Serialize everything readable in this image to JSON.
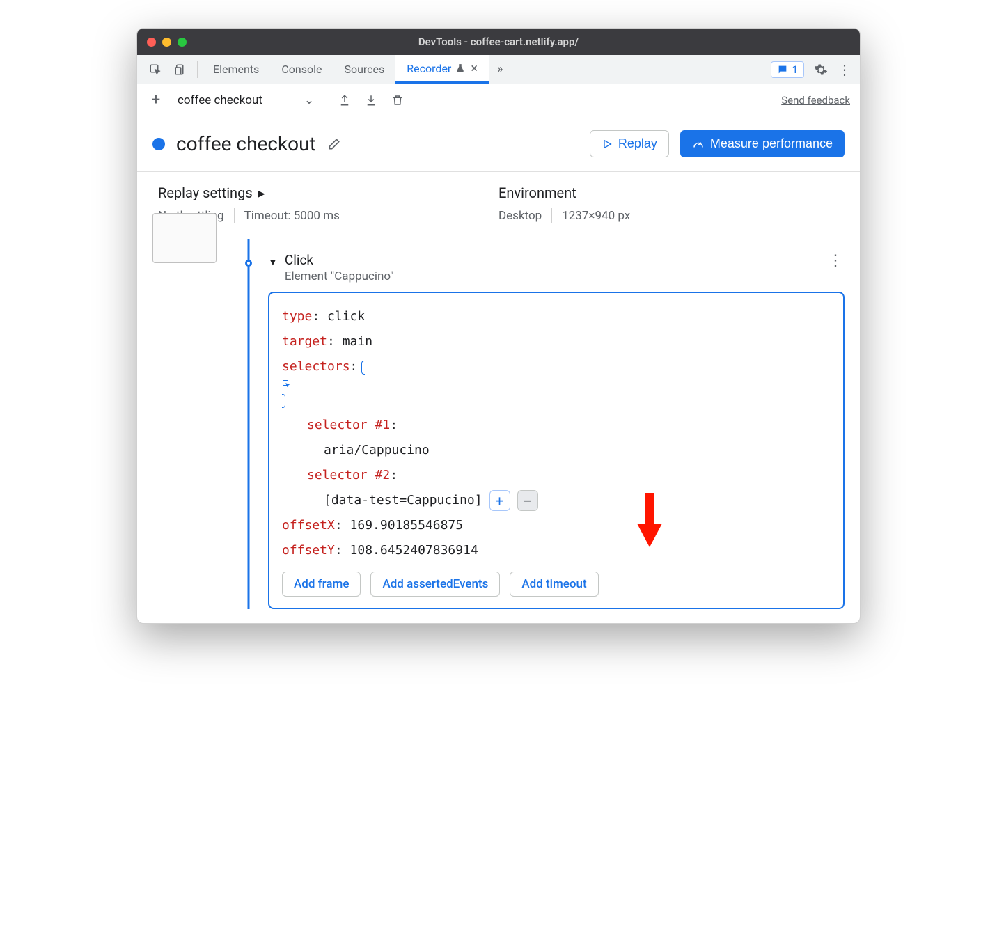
{
  "window_title": "DevTools - coffee-cart.netlify.app/",
  "tabs": [
    "Elements",
    "Console",
    "Sources"
  ],
  "active_tab": "Recorder",
  "messages_count": "1",
  "recording_dropdown": "coffee checkout",
  "feedback_link": "Send feedback",
  "recording_name": "coffee checkout",
  "btn_replay": "Replay",
  "btn_measure": "Measure performance",
  "replay_settings_title": "Replay settings",
  "throttling": "No throttling",
  "timeout": "Timeout: 5000 ms",
  "env_title": "Environment",
  "env_device": "Desktop",
  "env_viewport": "1237×940 px",
  "step": {
    "title": "Click",
    "subtitle": "Element \"Cappucino\"",
    "props": {
      "type_key": "type",
      "type_val": "click",
      "target_key": "target",
      "target_val": "main",
      "selectors_key": "selectors",
      "sel1_key": "selector #1",
      "sel1_val": "aria/Cappucino",
      "sel2_key": "selector #2",
      "sel2_val": "[data-test=Cappucino]",
      "offx_key": "offsetX",
      "offx_val": "169.90185546875",
      "offy_key": "offsetY",
      "offy_val": "108.6452407836914"
    }
  },
  "action_buttons": [
    "Add frame",
    "Add assertedEvents",
    "Add timeout"
  ]
}
